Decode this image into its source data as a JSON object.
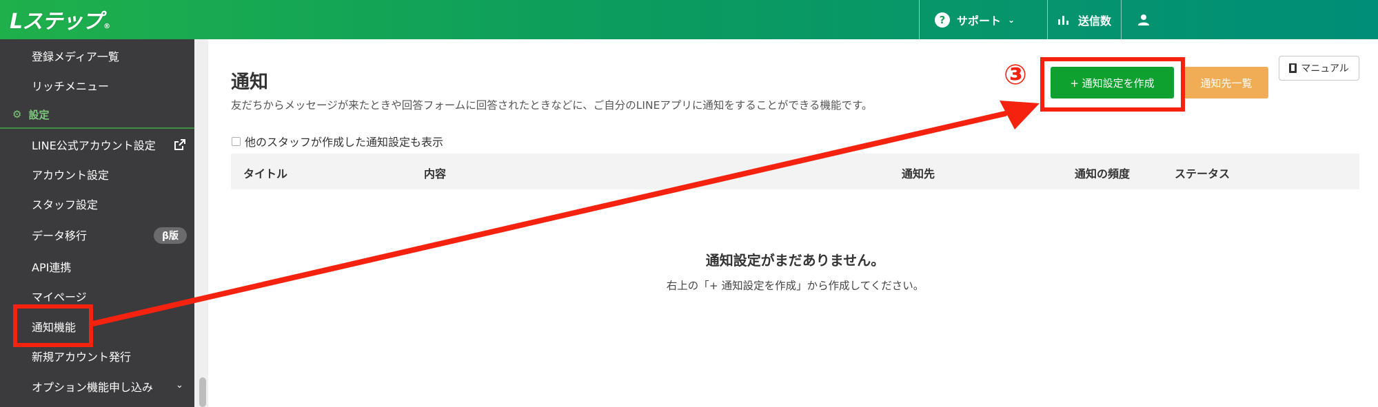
{
  "header": {
    "logo_text": "Lステップ",
    "logo_mark": "®",
    "support_label": "サポート",
    "count_label": "送信数",
    "user_name": ""
  },
  "sidebar": {
    "items": [
      {
        "label": "登録メディア一覧"
      },
      {
        "label": "リッチメニュー"
      }
    ],
    "section_label": "設定",
    "settings_items": [
      {
        "label": "LINE公式アカウント設定"
      },
      {
        "label": "アカウント設定"
      },
      {
        "label": "スタッフ設定"
      },
      {
        "label": "データ移行",
        "badge": "β版"
      },
      {
        "label": "API連携"
      },
      {
        "label": "マイページ"
      },
      {
        "label": "通知機能"
      },
      {
        "label": "新規アカウント発行"
      },
      {
        "label": "オプション機能申し込み"
      }
    ]
  },
  "main": {
    "title": "通知",
    "description": "友だちからメッセージが来たときや回答フォームに回答されたときなどに、ご自分のLINEアプリに通知をすることができる機能です。",
    "create_button": "+ 通知設定を作成",
    "list_button": "通知先一覧",
    "manual_button": "マニュアル",
    "checkbox_label": "他のスタッフが作成した通知設定も表示",
    "columns": [
      "タイトル",
      "内容",
      "通知先",
      "通知の頻度",
      "ステータス"
    ],
    "empty_title": "通知設定がまだありません。",
    "empty_sub": "右上の「+ 通知設定を作成」から作成してください。"
  },
  "annotation": {
    "step_number": "③",
    "color": "#f5220f"
  },
  "colors": {
    "header_green": "#1fb04b",
    "sidebar_bg": "#3b3b3d",
    "primary_button": "#0ea12f",
    "secondary_button": "#f0ad55"
  }
}
